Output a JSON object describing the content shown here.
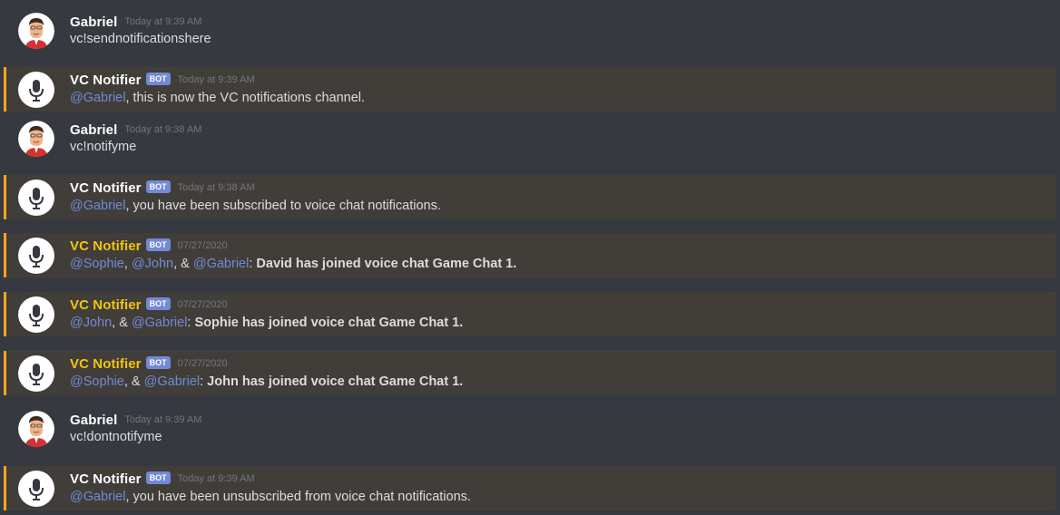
{
  "messages": [
    {
      "author": "Gabriel",
      "time": "Today at 9:39 AM",
      "text": "vc!sendnotificationshere"
    },
    {
      "author": "VC Notifier",
      "bot": "BOT",
      "time": "Today at 9:39 AM",
      "mention": "@Gabriel",
      "text": ", this is now the VC notifications channel."
    },
    {
      "author": "Gabriel",
      "time": "Today at 9:38 AM",
      "text": "vc!notifyme"
    },
    {
      "author": "VC Notifier",
      "bot": "BOT",
      "time": "Today at 9:38 AM",
      "mention": "@Gabriel",
      "text": ", you have been subscribed to voice chat notifications."
    },
    {
      "author": "VC Notifier",
      "bot": "BOT",
      "time": "07/27/2020",
      "m1": "@Sophie",
      "sep1": ", ",
      "m2": "@John",
      "sep2": ", & ",
      "m3": "@Gabriel",
      "sep3": ": ",
      "bold": "David has joined voice chat Game Chat 1."
    },
    {
      "author": "VC Notifier",
      "bot": "BOT",
      "time": "07/27/2020",
      "m1": "@John",
      "sep1": ", & ",
      "m2": "@Gabriel",
      "sep2": ": ",
      "bold": "Sophie has joined voice chat Game Chat 1."
    },
    {
      "author": "VC Notifier",
      "bot": "BOT",
      "time": "07/27/2020",
      "m1": "@Sophie",
      "sep1": ", & ",
      "m2": "@Gabriel",
      "sep2": ": ",
      "bold": "John has joined voice chat Game Chat 1."
    },
    {
      "author": "Gabriel",
      "time": "Today at 9:39 AM",
      "text": "vc!dontnotifyme"
    },
    {
      "author": "VC Notifier",
      "bot": "BOT",
      "time": "Today at 9:39 AM",
      "mention": "@Gabriel",
      "text": ", you have been unsubscribed from voice chat notifications."
    }
  ],
  "colors": {
    "background": "#36393f",
    "mention_highlight": "#413e39",
    "mention_bar": "#faa61a",
    "mention_text": "#7289da",
    "bot_tag": "#7289da",
    "gold_name": "#f1c40f"
  },
  "icons": {
    "bot_avatar": "microphone-icon",
    "user_avatar": "cartoon-man-avatar"
  }
}
